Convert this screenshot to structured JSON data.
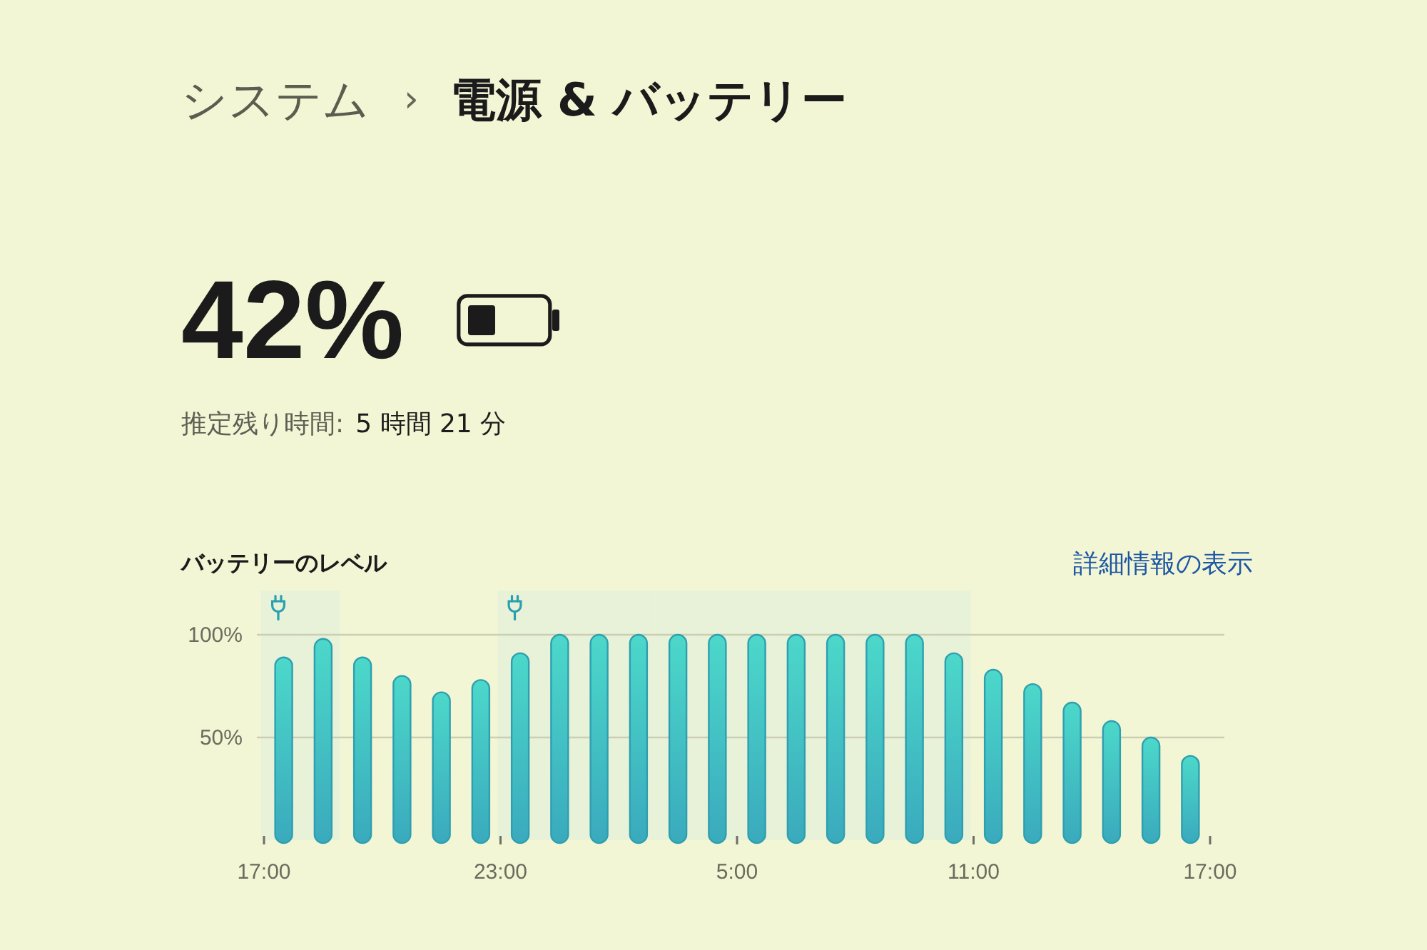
{
  "breadcrumb": {
    "parent": "システム",
    "separator": "›",
    "current": "電源 & バッテリー"
  },
  "battery": {
    "percent": "42%",
    "estimate_label": "推定残り時間:",
    "estimate_value": "5 時間 21 分"
  },
  "battery_level": {
    "link": "詳細情報の表示",
    "charging": [
      true,
      true,
      false,
      false,
      false,
      false,
      true,
      true,
      true,
      true,
      true,
      true,
      true,
      true,
      true,
      true,
      true,
      true,
      false,
      false,
      false,
      false,
      false,
      false
    ],
    "chart_data": {
      "type": "bar",
      "title": "バッテリーのレベル",
      "categories": [
        "17:00",
        null,
        null,
        null,
        null,
        null,
        "23:00",
        null,
        null,
        null,
        null,
        null,
        "5:00",
        null,
        null,
        null,
        null,
        null,
        "11:00",
        null,
        null,
        null,
        null,
        null,
        "17:00"
      ],
      "values": [
        89,
        98,
        89,
        80,
        72,
        78,
        91,
        100,
        100,
        100,
        100,
        100,
        100,
        100,
        100,
        100,
        100,
        91,
        83,
        76,
        67,
        58,
        50,
        41,
        null
      ],
      "ylim": [
        0,
        100
      ],
      "yticks": [
        {
          "value": 50,
          "label": "50%"
        },
        {
          "value": 100,
          "label": "100%"
        }
      ]
    }
  }
}
